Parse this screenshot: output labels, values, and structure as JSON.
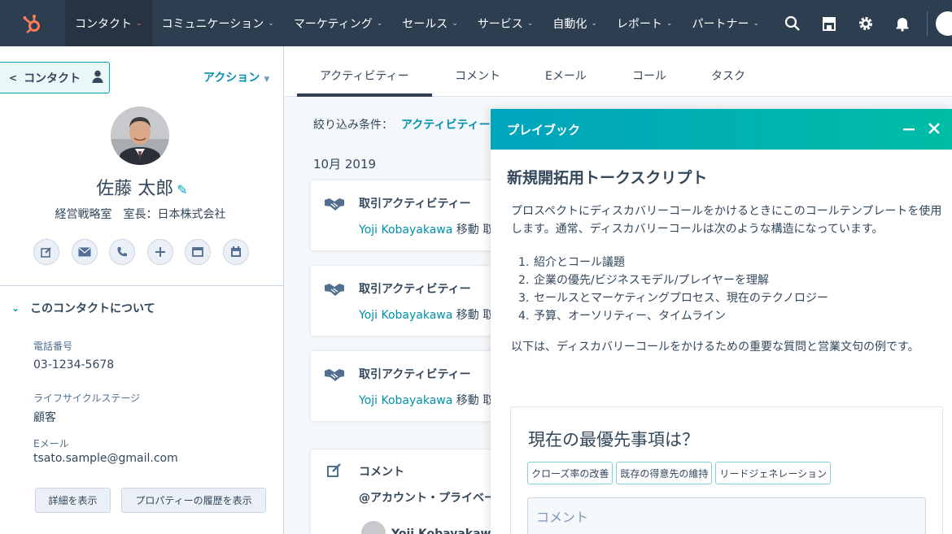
{
  "nav": {
    "items": [
      {
        "label": "コンタクト",
        "active": true
      },
      {
        "label": "コミュニケーション",
        "active": false
      },
      {
        "label": "マーケティング",
        "active": false
      },
      {
        "label": "セールス",
        "active": false
      },
      {
        "label": "サービス",
        "active": false
      },
      {
        "label": "自動化",
        "active": false
      },
      {
        "label": "レポート",
        "active": false
      },
      {
        "label": "パートナー",
        "active": false
      }
    ],
    "icons": [
      "search-icon",
      "marketplace-icon",
      "settings-icon",
      "notifications-icon"
    ],
    "accent": "#ff7a59",
    "bg": "#2d3e50"
  },
  "contact": {
    "back_label": "コンタクト",
    "actions_label": "アクション",
    "name": "佐藤 太郎",
    "title": "経営戦略室　室長：日本株式会社",
    "buttons": [
      "note-icon",
      "email-icon",
      "call-icon",
      "add-icon",
      "log-icon",
      "meeting-icon"
    ],
    "about_heading": "このコンタクトについて",
    "props": [
      {
        "label": "電話番号",
        "value": "03-1234-5678"
      },
      {
        "label": "ライフサイクルステージ",
        "value": "顧客"
      },
      {
        "label": "Eメール",
        "value": "tsato.sample@gmail.com"
      }
    ],
    "view_details": "詳細を表示",
    "view_history": "プロパティーの履歴を表示"
  },
  "timeline": {
    "tabs": [
      "アクティビティー",
      "コメント",
      "Eメール",
      "コール",
      "タスク"
    ],
    "filter_label": "絞り込み条件：",
    "filter_value": "アクティビティー",
    "month": "10月 2019",
    "cards": [
      {
        "title": "取引アクティビティー",
        "who": "Yoji Kobayakawa",
        "rest": " 移動 取引"
      },
      {
        "title": "取引アクティビティー",
        "who": "Yoji Kobayakawa",
        "rest": " 移動 取引"
      },
      {
        "title": "取引アクティビティー",
        "who": "Yoji Kobayakawa",
        "rest": " 移動 取引"
      },
      {
        "title": "コメント",
        "who": "",
        "rest": "@アカウント・プライベー"
      }
    ],
    "comment_author": "Yoji Kobayakawaさ"
  },
  "playbook": {
    "header": "プレイブック",
    "title": "新規開拓用トークスクリプト",
    "para": "プロスペクトにディスカバリーコールをかけるときにこのコールテンプレートを使用します。通常、ディスカバリーコールは次のような構造になっています。",
    "list": [
      "紹介とコール議題",
      "企業の優先/ビジネスモデル/プレイヤーを理解",
      "セールスとマーケティングプロセス、現在のテクノロジー",
      "予算、オーソリティー、タイムライン"
    ],
    "note": "以下は、ディスカバリーコールをかけるための重要な質問と営業文句の例です。",
    "question": "現在の最優先事項は？",
    "tags": [
      "クローズ率の改善",
      "既存の得意先の維持",
      "リードジェネレーション"
    ],
    "comment_placeholder": "コメント"
  }
}
